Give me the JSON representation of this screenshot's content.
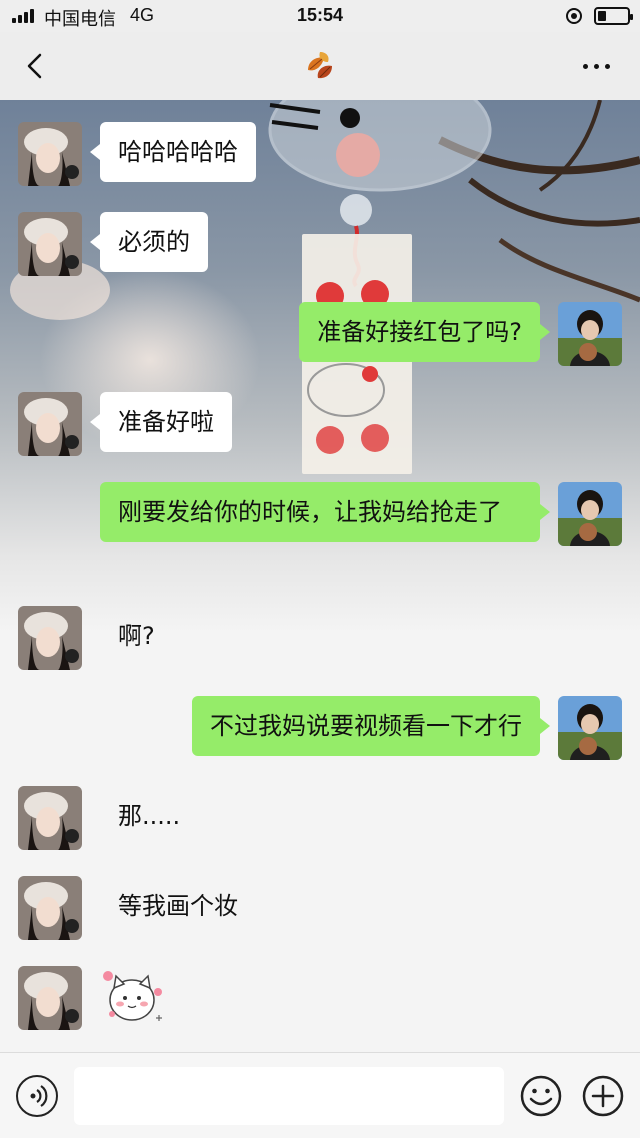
{
  "status_bar": {
    "carrier": "中国电信",
    "network": "4G",
    "time": "15:54",
    "battery_level": 0.3
  },
  "nav": {
    "back_icon": "chevron-left-icon",
    "title_icon": "autumn-leaf-icon",
    "more_icon": "more-dots-icon"
  },
  "messages": [
    {
      "side": "left",
      "type": "text",
      "text": "哈哈哈哈哈"
    },
    {
      "side": "left",
      "type": "text",
      "text": "必须的"
    },
    {
      "side": "right",
      "type": "text",
      "text": "准备好接红包了吗?"
    },
    {
      "side": "left",
      "type": "text",
      "text": "准备好啦"
    },
    {
      "side": "right",
      "type": "text",
      "text": "刚要发给你的时候，让我妈给抢走了"
    },
    {
      "side": "left",
      "type": "text",
      "text": "啊?"
    },
    {
      "side": "right",
      "type": "text",
      "text": "不过我妈说要视频看一下才行"
    },
    {
      "side": "left",
      "type": "text",
      "text": "那....."
    },
    {
      "side": "left",
      "type": "text",
      "text": "等我画个妆"
    },
    {
      "side": "left",
      "type": "sticker",
      "sticker": "cat-sticker-icon"
    }
  ],
  "input_bar": {
    "voice_icon": "voice-icon",
    "input_value": "",
    "emoji_icon": "emoji-icon",
    "plus_icon": "plus-icon"
  },
  "colors": {
    "self_bubble": "#95ec69",
    "other_bubble": "#ffffff",
    "bar_background": "#ededed"
  }
}
